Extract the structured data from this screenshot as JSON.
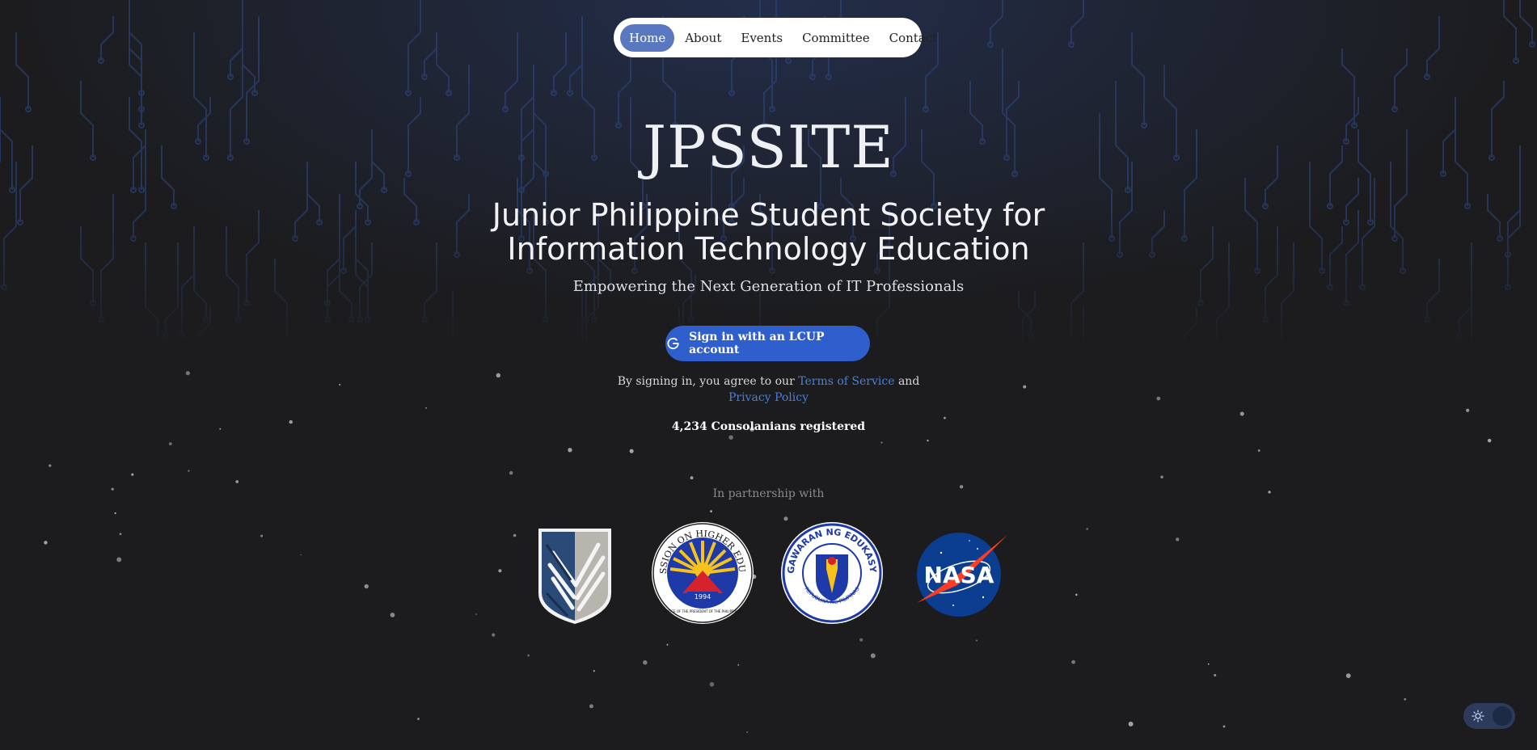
{
  "nav": {
    "items": [
      {
        "label": "Home",
        "active": true
      },
      {
        "label": "About",
        "active": false
      },
      {
        "label": "Events",
        "active": false
      },
      {
        "label": "Committee",
        "active": false
      },
      {
        "label": "Contact",
        "active": false
      }
    ]
  },
  "hero": {
    "title": "JPSSITE",
    "subtitle_line1": "Junior Philippine Student Society for",
    "subtitle_line2": "Information Technology Education",
    "tagline": "Empowering the Next Generation of IT Professionals"
  },
  "signin": {
    "button_label": "Sign in with an LCUP account",
    "icon": "google-icon"
  },
  "terms": {
    "prefix": "By signing in, you agree to our ",
    "terms_link": "Terms of Service",
    "middle": " and",
    "privacy_link": "Privacy Policy"
  },
  "registered": {
    "count": "4,234",
    "label": "Consolanians registered"
  },
  "partners": {
    "label": "In partnership with",
    "logos": [
      {
        "name": "Wings of Freedom emblem"
      },
      {
        "name": "Commission on Higher Education",
        "text": "COMMISSION ON HIGHER EDUCATION",
        "year": "1994",
        "small": "OFFICE OF THE PRESIDENT OF THE PHILIPPINES"
      },
      {
        "name": "Kagawaran ng Edukasyon",
        "text": "KAGAWARAN NG EDUKASYON",
        "bottom": "REPUBLIKA NG PILIPINAS"
      },
      {
        "name": "NASA",
        "text": "NASA"
      }
    ]
  },
  "theme_toggle": {
    "icon": "sun-icon",
    "mode": "dark"
  },
  "colors": {
    "background": "#1c1c1e",
    "accent": "#2f5fcc",
    "nav_active": "#5a78c0",
    "link": "#4a7fd8"
  }
}
